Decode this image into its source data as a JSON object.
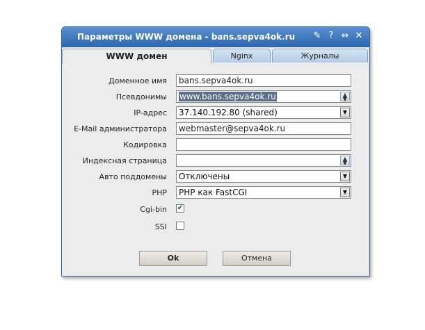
{
  "window": {
    "title": "Параметры WWW домена - bans.sepva4ok.ru"
  },
  "titlebar_icons": [
    {
      "name": "pin-icon",
      "glyph": "✎"
    },
    {
      "name": "help-icon",
      "glyph": "?"
    },
    {
      "name": "resize-icon",
      "glyph": "⇔"
    },
    {
      "name": "close-icon",
      "glyph": "✕"
    }
  ],
  "tabs": [
    {
      "label": "WWW домен",
      "active": true
    },
    {
      "label": "Nginx",
      "active": false
    },
    {
      "label": "Журналы",
      "active": false
    }
  ],
  "form": {
    "domain_name": {
      "label": "Доменное имя",
      "value": "bans.sepva4ok.ru"
    },
    "aliases": {
      "label": "Псевдонимы",
      "value": "www.bans.sepva4ok.ru"
    },
    "ip_address": {
      "label": "IP-адрес",
      "value": "37.140.192.80 (shared)"
    },
    "admin_email": {
      "label": "E-Mail администратора",
      "value": "webmaster@sepva4ok.ru"
    },
    "encoding": {
      "label": "Кодировка",
      "value": ""
    },
    "index_page": {
      "label": "Индексная страница",
      "value": ""
    },
    "auto_subdomains": {
      "label": "Авто поддомены",
      "value": "Отключены"
    },
    "php": {
      "label": "PHP",
      "value": "PHP как FastCGI"
    },
    "cgi_bin": {
      "label": "Cgi-bin",
      "checked": true
    },
    "ssi": {
      "label": "SSI",
      "checked": false
    }
  },
  "buttons": {
    "ok": "Ok",
    "cancel": "Отмена"
  },
  "colors": {
    "titlebar": "#2d66ae",
    "dialog_bg": "#ececec",
    "selection": "#5a6d89"
  }
}
